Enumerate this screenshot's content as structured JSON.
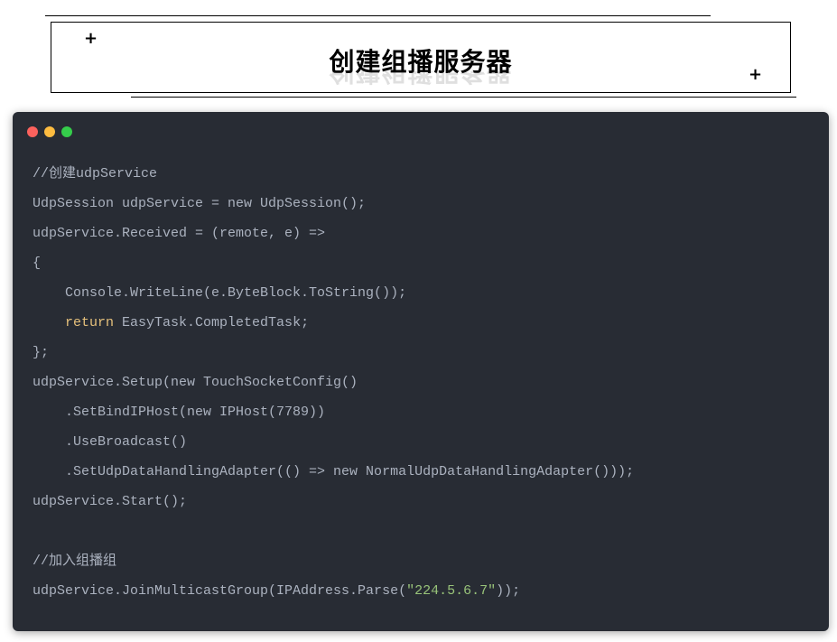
{
  "header": {
    "title": "创建组播服务器",
    "plus_icon": "+"
  },
  "code_window": {
    "controls": [
      "close",
      "minimize",
      "maximize"
    ],
    "colors": {
      "close": "#fc625d",
      "minimize": "#fdbc40",
      "maximize": "#35cd4b",
      "background": "#282c34",
      "keyword": "#e5c07b",
      "string": "#98c379"
    },
    "lines": [
      [
        {
          "t": "//创建udpService"
        }
      ],
      [
        {
          "t": "UdpSession udpService = new UdpSession();"
        }
      ],
      [
        {
          "t": "udpService.Received = (remote, e) =>"
        }
      ],
      [
        {
          "t": "{"
        }
      ],
      [
        {
          "t": "    Console.WriteLine(e.ByteBlock.ToString());"
        }
      ],
      [
        {
          "t": "    "
        },
        {
          "t": "return",
          "c": "kw"
        },
        {
          "t": " EasyTask.CompletedTask;"
        }
      ],
      [
        {
          "t": "};"
        }
      ],
      [
        {
          "t": "udpService.Setup(new TouchSocketConfig()"
        }
      ],
      [
        {
          "t": "    .SetBindIPHost(new IPHost(7789))"
        }
      ],
      [
        {
          "t": "    .UseBroadcast()"
        }
      ],
      [
        {
          "t": "    .SetUdpDataHandlingAdapter(() => new NormalUdpDataHandlingAdapter()));"
        }
      ],
      [
        {
          "t": "udpService.Start();"
        }
      ],
      [
        {
          "t": ""
        }
      ],
      [
        {
          "t": "//加入组播组"
        }
      ],
      [
        {
          "t": "udpService.JoinMulticastGroup(IPAddress.Parse("
        },
        {
          "t": "\"224.5.6.7\"",
          "c": "str"
        },
        {
          "t": "));"
        }
      ]
    ]
  }
}
